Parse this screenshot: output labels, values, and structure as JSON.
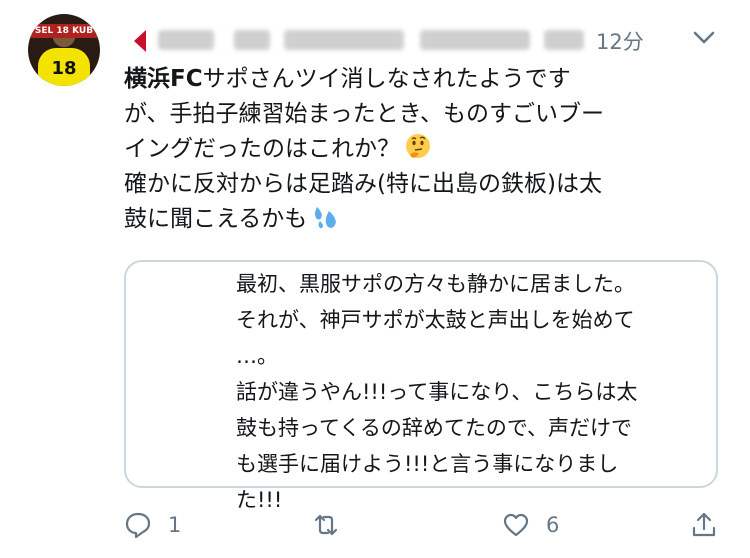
{
  "avatar": {
    "band_text": "SEL 18 KUB",
    "number": "18"
  },
  "header": {
    "time": "12分"
  },
  "tweet": {
    "lines": [
      "横浜FCサポさんツイ消しなされたようです",
      "が、手拍子練習始まったとき、ものすごいブー",
      "イングだったのはこれか？",
      "確かに反対からは足踏み(特に出島の鉄板)は太",
      "鼓に聞こえるかも"
    ],
    "bold_prefix": "横浜FC",
    "emoji_1": "thinking-face-emoji",
    "emoji_2": "sweat-droplets-emoji"
  },
  "quote": {
    "lines": [
      "最初、黒服サポの方々も静かに居ました。",
      "それが、神戸サポが太鼓と声出しを始めて",
      "…。",
      "話が違うやん!!!って事になり、こちらは太",
      "鼓も持ってくるの辞めてたので、声だけで",
      "も選手に届けよう!!!と言う事になりまし",
      "た!!!"
    ]
  },
  "actions": {
    "reply_count": "1",
    "retweet_count": "",
    "like_count": "6"
  },
  "colors": {
    "muted": "#657786",
    "border": "#ccd6dd",
    "text": "#14171a"
  }
}
